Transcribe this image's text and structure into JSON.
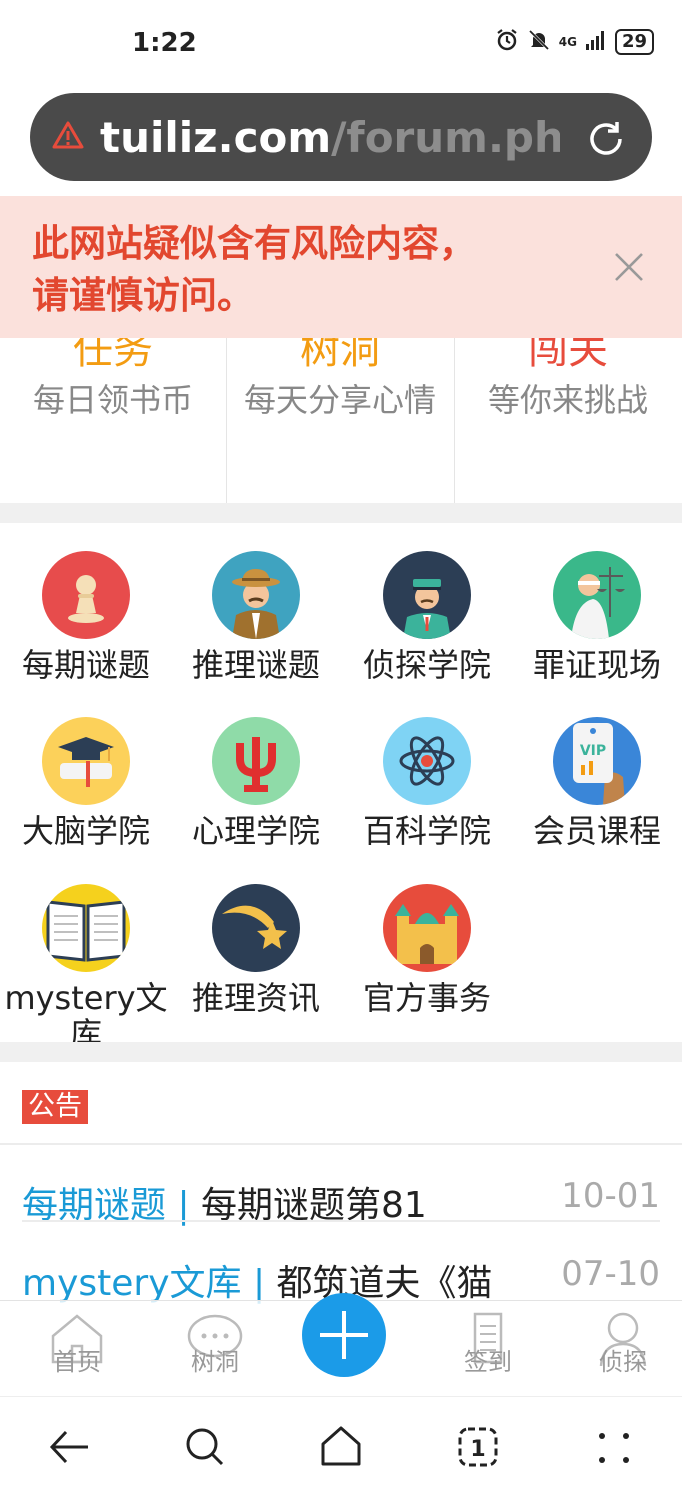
{
  "status": {
    "time": "1:22",
    "network": "4G",
    "battery": "29"
  },
  "url": {
    "domain": "tuiliz.com",
    "path": "/forum.php?mobile"
  },
  "risk": {
    "line1": "此网站疑似含有风险内容，",
    "line2": "请谨慎访问。"
  },
  "features": [
    {
      "title": "任务",
      "subtitle": "每日领书币",
      "color": "#f39c12"
    },
    {
      "title": "树洞",
      "subtitle": "每天分享心情",
      "color": "#f39c12"
    },
    {
      "title": "闯关",
      "subtitle": "等你来挑战",
      "color": "#e74c3c"
    }
  ],
  "grid": [
    {
      "label": "每期谜题",
      "icon": "chess-pawn-icon"
    },
    {
      "label": "推理谜题",
      "icon": "detective-icon"
    },
    {
      "label": "侦探学院",
      "icon": "police-officer-icon"
    },
    {
      "label": "罪证现场",
      "icon": "justice-scales-icon"
    },
    {
      "label": "大脑学院",
      "icon": "graduation-cap-icon"
    },
    {
      "label": "心理学院",
      "icon": "psi-icon"
    },
    {
      "label": "百科学院",
      "icon": "atom-icon"
    },
    {
      "label": "会员课程",
      "icon": "vip-card-icon"
    },
    {
      "label": "mystery文库",
      "icon": "open-book-icon"
    },
    {
      "label": "推理资讯",
      "icon": "shooting-star-icon"
    },
    {
      "label": "官方事务",
      "icon": "castle-icon"
    }
  ],
  "notice": {
    "badge": "公告",
    "rows": [
      {
        "category": "每期谜题",
        "title": "每期谜题第81",
        "date": "10-01"
      },
      {
        "category": "mystery文库",
        "title": "都筑道夫《猫",
        "date": "07-10"
      }
    ]
  },
  "tabs": [
    "首页",
    "树洞",
    "签到",
    "侦探"
  ]
}
